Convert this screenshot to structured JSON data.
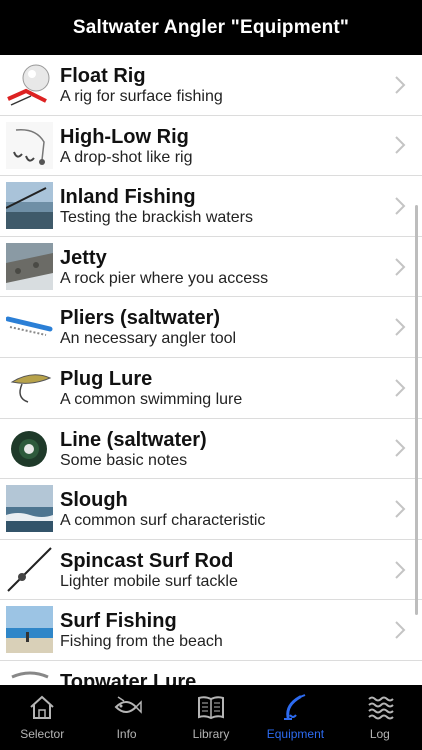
{
  "nav": {
    "title": "Saltwater Angler \"Equipment\""
  },
  "items": [
    {
      "title": "Float Rig",
      "subtitle": "A rig for surface fishing",
      "thumbnail": "float-rig"
    },
    {
      "title": "High-Low Rig",
      "subtitle": "A drop-shot like rig",
      "thumbnail": "high-low-rig"
    },
    {
      "title": "Inland Fishing",
      "subtitle": "Testing the brackish waters",
      "thumbnail": "inland-fishing"
    },
    {
      "title": "Jetty",
      "subtitle": "A rock pier where you access",
      "thumbnail": "jetty"
    },
    {
      "title": "Pliers (saltwater)",
      "subtitle": "An necessary angler tool",
      "thumbnail": "pliers"
    },
    {
      "title": "Plug Lure",
      "subtitle": "A common swimming lure",
      "thumbnail": "plug-lure"
    },
    {
      "title": "Line (saltwater)",
      "subtitle": "Some basic notes",
      "thumbnail": "line-spool"
    },
    {
      "title": "Slough",
      "subtitle": "A common surf characteristic",
      "thumbnail": "slough"
    },
    {
      "title": "Spincast Surf Rod",
      "subtitle": "Lighter mobile surf tackle",
      "thumbnail": "spincast-rod"
    },
    {
      "title": "Surf Fishing",
      "subtitle": "Fishing from the beach",
      "thumbnail": "surf-fishing"
    },
    {
      "title": "Topwater Lure",
      "subtitle": "",
      "thumbnail": "topwater-lure"
    }
  ],
  "tabs": [
    {
      "label": "Selector",
      "icon": "house-icon",
      "active": false
    },
    {
      "label": "Info",
      "icon": "fish-info-icon",
      "active": false
    },
    {
      "label": "Library",
      "icon": "book-icon",
      "active": false
    },
    {
      "label": "Equipment",
      "icon": "lure-icon",
      "active": true
    },
    {
      "label": "Log",
      "icon": "waves-icon",
      "active": false
    }
  ],
  "colors": {
    "accent": "#2d6bf0",
    "bar": "#000000",
    "inactive_tab": "#b5b5b5"
  }
}
